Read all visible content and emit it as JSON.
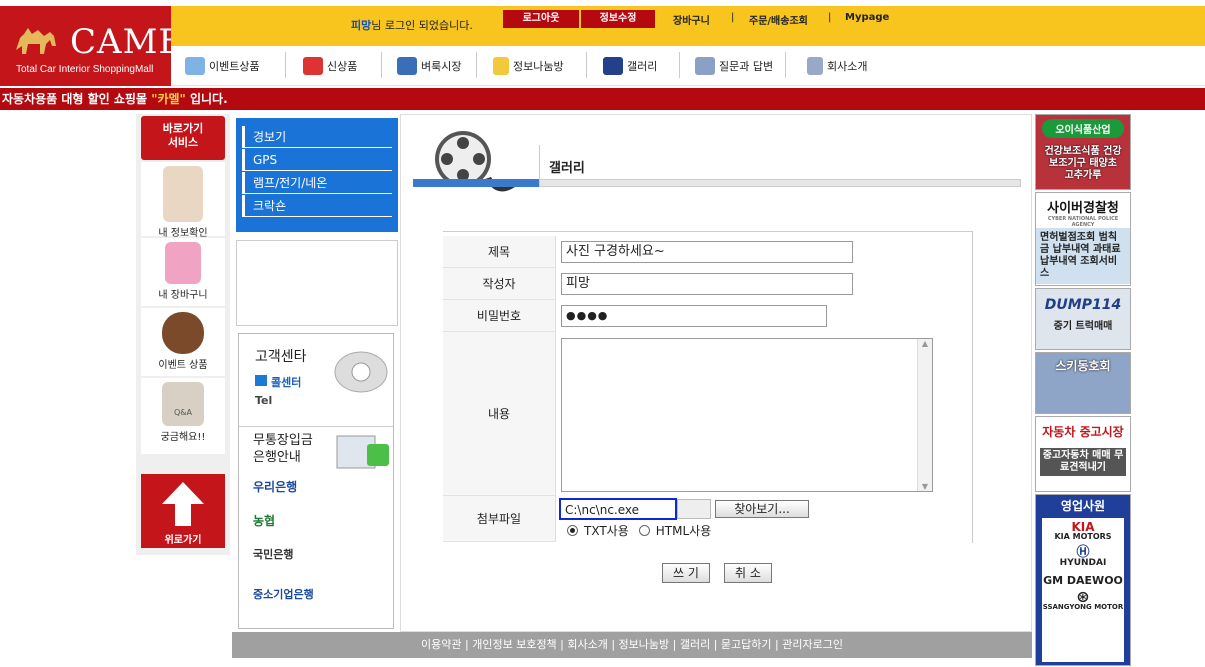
{
  "logo": {
    "word": "CAMEL",
    "sub": "Total Car Interior ShoppingMall"
  },
  "top": {
    "user": "피망",
    "login_msg": "님 로그인 되었습니다.",
    "logout": "로그아웃",
    "edit_info": "정보수정",
    "cart": "장바구니",
    "order": "주문/배송조회",
    "mypage": "Mypage",
    "sep": "|"
  },
  "nav": [
    "이벤트상품",
    "신상품",
    "벼룩시장",
    "정보나눔방",
    "갤러리",
    "질문과 답변",
    "회사소개"
  ],
  "banner": {
    "pre": "자동차용품 대형 할인 쇼핑몰 ",
    "hl": "\"카멜\"",
    "post": " 입니다."
  },
  "quick": {
    "title1": "바로가기",
    "title2": "서비스",
    "items": [
      "내 정보확인",
      "내 장바구니",
      "이벤트 상품",
      "궁금해요!!"
    ],
    "qa": "Q&A",
    "up": "위로가기"
  },
  "categories": [
    "경보기",
    "GPS",
    "램프/전기/네온",
    "크락숀"
  ],
  "customer": {
    "title": "고객센타",
    "call": "콜센터",
    "tel": "Tel",
    "bank_title1": "무통장입금",
    "bank_title2": "은행안내",
    "banks": [
      "우리은행",
      "농협",
      "국민은행",
      "중소기업은행"
    ]
  },
  "gallery": {
    "title": "갤러리"
  },
  "form": {
    "labels": {
      "subject": "제목",
      "author": "작성자",
      "password": "비밀번호",
      "content": "내용",
      "attach": "첨부파일"
    },
    "subject": "사진 구경하세요~",
    "author": "피망",
    "password": "●●●●",
    "attach": "C:\\nc\\nc.exe",
    "browse": "찾아보기...",
    "radio_txt": "TXT사용",
    "radio_html": "HTML사용",
    "write": "쓰 기",
    "cancel": "취 소"
  },
  "right_banners": [
    {
      "title": "오이식품산업",
      "body": "건강보조식품 건강보조기구 태양초 고추가루"
    },
    {
      "title": "사이버경찰청",
      "sub": "CYBER NATIONAL POLICE AGENCY",
      "body": "면허벌점조회 범칙금 납부내역 과태료 납부내역 조회서비스"
    },
    {
      "title": "DUMP114",
      "body": "중기 트럭매매"
    },
    {
      "title": "스키동호회"
    },
    {
      "title": "자동차 중고시장",
      "body": "중고자동차 매매 무료견적내기"
    },
    {
      "title": "영업사원",
      "brands": [
        "KIA MOTORS",
        "HYUNDAI",
        "GM DAEWOO",
        "SSANGYONG MOTOR"
      ]
    }
  ],
  "footer": "이용약관 | 개인정보 보호정책 | 회사소개 | 정보나눔방 | 갤러리 | 묻고답하기 | 관리자로그인",
  "colors": {
    "brand_red": "#c4151b",
    "top_yellow": "#f7c51e",
    "cat_blue": "#1a73d6",
    "highlight": "#ffd23a"
  }
}
